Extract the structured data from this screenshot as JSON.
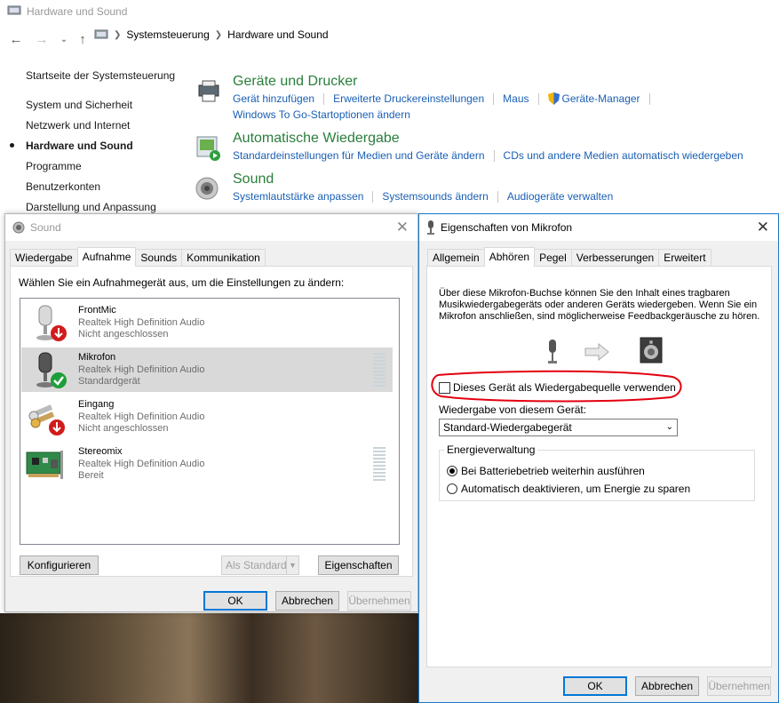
{
  "window": {
    "title": "Hardware und Sound",
    "breadcrumb": [
      "Systemsteuerung",
      "Hardware und Sound"
    ]
  },
  "sidebar": {
    "items": [
      {
        "label": "Startseite der Systemsteuerung"
      },
      {
        "label": "System und Sicherheit"
      },
      {
        "label": "Netzwerk und Internet"
      },
      {
        "label": "Hardware und Sound",
        "active": true
      },
      {
        "label": "Programme"
      },
      {
        "label": "Benutzerkonten"
      },
      {
        "label": "Darstellung und Anpassung"
      }
    ]
  },
  "categories": [
    {
      "title": "Geräte und Drucker",
      "icon": "printer-icon",
      "links": [
        "Gerät hinzufügen",
        "Erweiterte Druckereinstellungen",
        "Maus",
        "Geräte-Manager"
      ],
      "links2": [
        "Windows To Go-Startoptionen ändern"
      ]
    },
    {
      "title": "Automatische Wiedergabe",
      "icon": "autoplay-icon",
      "links": [
        "Standardeinstellungen für Medien und Geräte ändern",
        "CDs und andere Medien automatisch wiedergeben"
      ]
    },
    {
      "title": "Sound",
      "icon": "speaker-icon",
      "links": [
        "Systemlautstärke anpassen",
        "Systemsounds ändern",
        "Audiogeräte verwalten"
      ]
    }
  ],
  "sound_dialog": {
    "title": "Sound",
    "tabs": [
      "Wiedergabe",
      "Aufnahme",
      "Sounds",
      "Kommunikation"
    ],
    "selected_tab": "Aufnahme",
    "instruction": "Wählen Sie ein Aufnahmegerät aus, um die Einstellungen zu ändern:",
    "devices": [
      {
        "name": "FrontMic",
        "driver": "Realtek High Definition Audio",
        "status": "Nicht angeschlossen",
        "icon": "microphone-icon"
      },
      {
        "name": "Mikrofon",
        "driver": "Realtek High Definition Audio",
        "status": "Standardgerät",
        "icon": "microphone-icon",
        "selected": true
      },
      {
        "name": "Eingang",
        "driver": "Realtek High Definition Audio",
        "status": "Nicht angeschlossen",
        "icon": "line-in-icon"
      },
      {
        "name": "Stereomix",
        "driver": "Realtek High Definition Audio",
        "status": "Bereit",
        "icon": "sound-card-icon"
      }
    ],
    "buttons": {
      "configure": "Konfigurieren",
      "set_default": "Als Standard",
      "properties": "Eigenschaften",
      "ok": "OK",
      "cancel": "Abbrechen",
      "apply": "Übernehmen"
    }
  },
  "mic_dialog": {
    "title": "Eigenschaften von Mikrofon",
    "tabs": [
      "Allgemein",
      "Abhören",
      "Pegel",
      "Verbesserungen",
      "Erweitert"
    ],
    "selected_tab": "Abhören",
    "description": "Über diese Mikrofon-Buchse können Sie den Inhalt eines tragbaren Musikwiedergabegeräts oder anderen Geräts wiedergeben. Wenn Sie ein Mikrofon anschließen, sind möglicherweise Feedbackgeräusche zu hören.",
    "listen_checkbox": {
      "label": "Dieses Gerät als Wiedergabequelle verwenden",
      "checked": false
    },
    "playback_label": "Wiedergabe von diesem Gerät:",
    "playback_device": "Standard-Wiedergabegerät",
    "power_group": "Energieverwaltung",
    "power_options": [
      {
        "label": "Bei Batteriebetrieb weiterhin ausführen",
        "selected": true
      },
      {
        "label": "Automatisch deaktivieren, um Energie zu sparen",
        "selected": false
      }
    ],
    "buttons": {
      "ok": "OK",
      "cancel": "Abbrechen",
      "apply": "Übernehmen"
    }
  },
  "colors": {
    "link": "#1a5fb4",
    "category_title": "#2a7e3c",
    "accent": "#0078d7",
    "annotation": "#e3000f"
  }
}
